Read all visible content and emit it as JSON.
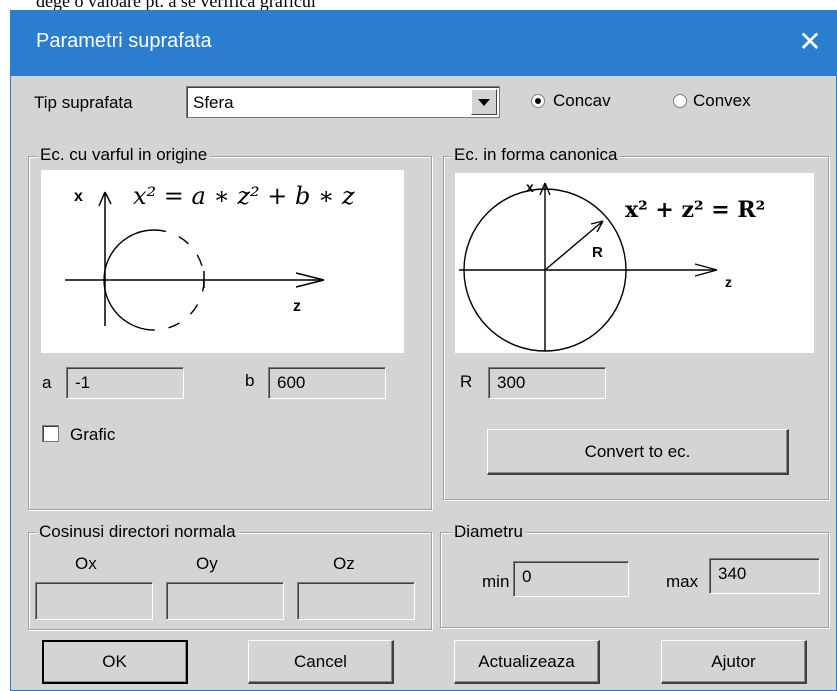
{
  "background_caption": "dege o valoare pt. a se verifica graficul",
  "window": {
    "title": "Parametri suprafata"
  },
  "surface_type": {
    "label": "Tip suprafata",
    "value": "Sfera"
  },
  "orientation": {
    "concav_label": "Concav",
    "convex_label": "Convex",
    "selected": "Concav"
  },
  "origin_eq": {
    "legend": "Ec. cu varful in origine",
    "axis_x": "x",
    "axis_z": "z",
    "formula": "x² = a ∗ z² + b ∗ z",
    "a_label": "a",
    "a_value": "-1",
    "b_label": "b",
    "b_value": "600",
    "grafic_label": "Grafic",
    "grafic_checked": false
  },
  "canonical_eq": {
    "legend": "Ec. in forma canonica",
    "axis_x": "x",
    "axis_z": "z",
    "radius_mark": "R",
    "formula": "x² + z² = R²",
    "r_label": "R",
    "r_value": "300",
    "convert_button": "Convert to ec."
  },
  "cosines": {
    "legend": "Cosinusi directori normala",
    "ox_label": "Ox",
    "oy_label": "Oy",
    "oz_label": "Oz",
    "ox_value": "",
    "oy_value": "",
    "oz_value": ""
  },
  "diameter": {
    "legend": "Diametru",
    "min_label": "min",
    "min_value": "0",
    "max_label": "max",
    "max_value": "340"
  },
  "buttons": {
    "ok": "OK",
    "cancel": "Cancel",
    "update": "Actualizeaza",
    "help": "Ajutor"
  },
  "colors": {
    "titlebar": "#2b7dd0",
    "dialog_bg": "#d4d4d4",
    "panel_white": "#ffffff"
  },
  "icons": {
    "close": "close-icon",
    "dropdown": "chevron-down-icon"
  }
}
